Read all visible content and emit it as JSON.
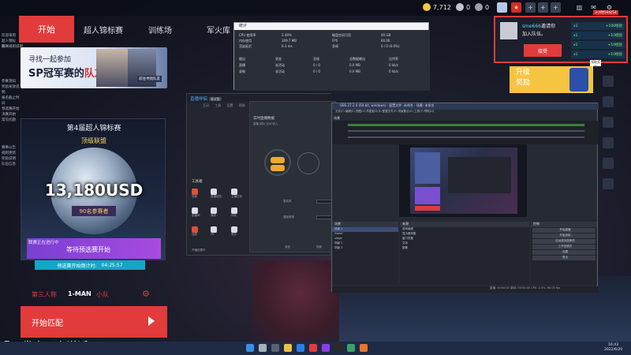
{
  "game": {
    "tabs": [
      "开始",
      "超人锦标赛",
      "训练场",
      "军火库"
    ],
    "currencies": [
      {
        "icon": "gold-coin-icon",
        "value": "7,712",
        "color": "#f5c542"
      },
      {
        "icon": "silver-coin-icon",
        "value": "0",
        "color": "#c0c4cc"
      },
      {
        "icon": "gem-icon",
        "value": "0",
        "color": "#9aa0a8"
      }
    ],
    "left_info_lines": [
      "欢迎来到超人锦标赛",
      "比赛规则说明",
      "参赛须知",
      "奖励发放说明",
      "报名截止时间",
      "预选赛开始",
      "决赛开始",
      "常见问题"
    ],
    "left_info_lines_2": [
      "赛事公告",
      "规则更新",
      "奖励说明",
      "队伍信息"
    ],
    "banner": {
      "line1": "寻找一起参加",
      "line2_prefix": "SP冠军赛的",
      "line2_highlight": "队友!",
      "badge": "前往寻找队友"
    },
    "tournament": {
      "title": "第4届超人锦标赛",
      "league": "顶级联盟",
      "prize": "13,180USD",
      "participants": "90名参赛者",
      "status_small": "联赛正在进行中",
      "status_main": "等待预选赛开始",
      "countdown_label": "预选赛开始倒计时:",
      "countdown_value": "04:25:57"
    },
    "team": {
      "mode": "第三人称",
      "size": "1-MAN",
      "type": "小队"
    },
    "start_match": "开始匹配"
  },
  "invite": {
    "name": "sme666",
    "invite_text": "邀请你",
    "join_text": "加入队伍。",
    "accept": "接受",
    "chips": [
      {
        "label": "x1",
        "value": "+100经验"
      },
      {
        "label": "x1",
        "value": "+10经验"
      },
      {
        "label": "x1",
        "value": "+10经验"
      },
      {
        "label": "x1",
        "value": "+10经验"
      }
    ],
    "header_badge": "3小时59分54"
  },
  "upgrade": {
    "line1": "升级",
    "line2": "奖励",
    "badge": "领取奖励"
  },
  "stats_window": {
    "title": "统计",
    "cells": [
      "CPU 使用率",
      "2.49%",
      "磁盘空间可用",
      "40 GB",
      "内存使用",
      "349.7 MB",
      "FPS",
      "60.00",
      "渲染延迟",
      "0.3 ms",
      "丢帧",
      "0 / 0 (0.0%)",
      "输出",
      "状态",
      "丢帧",
      "总数据输出",
      "比特率",
      "直播",
      "非活动",
      "0 / 0",
      "0.0 MB",
      "0 kb/s",
      "录制",
      "非活动",
      "0 / 0",
      "0.0 MB",
      "0 kb/s"
    ]
  },
  "app_window": {
    "logo_prefix": "直播",
    "logo_highlight": "伴侣",
    "version": "测试版",
    "nav": [
      "互动",
      "工具",
      "设置",
      "帮助"
    ],
    "section": "工具箱",
    "tools": [
      "场景",
      "直播信息",
      "主播任务",
      "直播间",
      "美颜",
      "特效",
      "连麦",
      "PK",
      "更多"
    ],
    "footer": "开播设置中"
  },
  "rec_panel": {
    "title": "实时直播数据",
    "tabs": [
      "直播",
      "观众",
      "互动",
      "收入"
    ],
    "mic_label": "麦克风",
    "desktop_label": "桌面音频",
    "item1": "添加",
    "item2": "场景"
  },
  "obs": {
    "title": "OBS 27.2.4 (64-bit, windows) - 配置文件: 未命名 - 场景: 未命名",
    "menu": [
      "文件(F)",
      "编辑(E)",
      "视图(V)",
      "停靠窗口(D)",
      "配置文件(P)",
      "场景集合(S)",
      "工具(T)",
      "帮助(H)"
    ],
    "scene_label": "场景",
    "docks": [
      "场景",
      "来源",
      "混音器",
      "转场特效",
      "控制"
    ],
    "scenes": [
      "场景 1",
      "Game",
      "stage",
      "场景 2",
      "场景 3"
    ],
    "sources": [
      "游戏画面",
      "显示器采集",
      "窗口采集",
      "文本",
      "图像"
    ],
    "controls": [
      "开始直播",
      "开始录制",
      "启动虚拟摄像机",
      "工作室模式",
      "设置",
      "退出"
    ],
    "status": "直播: 00:00:00  录制: 00:00:00  CPU: 2.5%, 60.00 fps"
  },
  "caption": "嗓子发炎了少说话",
  "taskbar": {
    "time": "16:43",
    "date": "2022/6/20"
  }
}
